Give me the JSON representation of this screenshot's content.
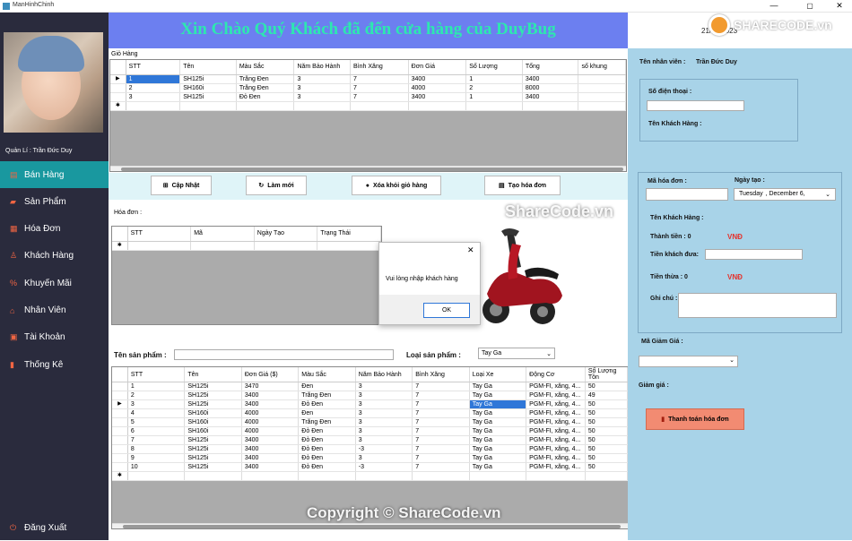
{
  "window": {
    "title": "ManHinhChinh"
  },
  "sidebar": {
    "manager_label": "Quản Lí : Trần Đức  Duy",
    "items": [
      {
        "icon": "store-icon",
        "label": "Bán Hàng"
      },
      {
        "icon": "car-icon",
        "label": "Sản Phẩm"
      },
      {
        "icon": "invoice-icon",
        "label": "Hóa Đơn"
      },
      {
        "icon": "user-icon",
        "label": "Khách Hàng"
      },
      {
        "icon": "percent-icon",
        "label": "Khuyến Mãi"
      },
      {
        "icon": "home-icon",
        "label": "Nhân Viên"
      },
      {
        "icon": "card-icon",
        "label": "Tài Khoản"
      },
      {
        "icon": "chart-icon",
        "label": "Thống Kê"
      }
    ],
    "logout_label": "Đăng Xuất"
  },
  "banner": {
    "text": "Xin Chào Quý Khách đã đến cửa hàng của DuyBug",
    "date": "21/09/2023"
  },
  "cart": {
    "label": "Giỏ Hàng",
    "columns": [
      "STT",
      "Tên",
      "Màu Sắc",
      "Năm Bảo Hành",
      "Bình Xăng",
      "Đơn Giá",
      "Số Lượng",
      "Tổng",
      "số khung"
    ],
    "rows": [
      [
        "1",
        "SH125i",
        "Trắng Đen",
        "3",
        "7",
        "3400",
        "1",
        "3400",
        ""
      ],
      [
        "2",
        "SH160i",
        "Trắng Đen",
        "3",
        "7",
        "4000",
        "2",
        "8000",
        ""
      ],
      [
        "3",
        "SH125i",
        "Đỏ Đen",
        "3",
        "7",
        "3400",
        "1",
        "3400",
        ""
      ]
    ]
  },
  "buttons": {
    "update": "Cập Nhật",
    "refresh": "Làm mới",
    "remove": "Xóa khỏi giỏ hàng",
    "create_invoice": "Tạo hóa đơn"
  },
  "invoice": {
    "label": "Hóa đơn :",
    "columns": [
      "STT",
      "Mã",
      "Ngày Tạo",
      "Trạng Thái"
    ]
  },
  "products": {
    "name_label": "Tên sản phẩm :",
    "name_value": "",
    "type_label": "Loại sản phẩm :",
    "type_value": "Tay Ga",
    "columns": [
      "STT",
      "Tên",
      "Đơn Giá ($)",
      "Màu Sắc",
      "Năm Bảo Hành",
      "Bình Xăng",
      "Loại Xe",
      "Động Cơ",
      "Số Lượng Tồn"
    ],
    "rows": [
      [
        "1",
        "SH125i",
        "3470",
        "Đen",
        "3",
        "7",
        "Tay Ga",
        "PGM-FI, xăng, 4...",
        "50"
      ],
      [
        "2",
        "SH125i",
        "3400",
        "Trắng Đen",
        "3",
        "7",
        "Tay Ga",
        "PGM-FI, xăng, 4...",
        "49"
      ],
      [
        "3",
        "SH125i",
        "3400",
        "Đỏ Đen",
        "3",
        "7",
        "Tay Ga",
        "PGM-FI, xăng, 4...",
        "50"
      ],
      [
        "4",
        "SH160i",
        "4000",
        "Đen",
        "3",
        "7",
        "Tay Ga",
        "PGM-FI, xăng, 4...",
        "50"
      ],
      [
        "5",
        "SH160i",
        "4000",
        "Trắng Đen",
        "3",
        "7",
        "Tay Ga",
        "PGM-FI, xăng, 4...",
        "50"
      ],
      [
        "6",
        "SH160i",
        "4000",
        "Đỏ Đen",
        "3",
        "7",
        "Tay Ga",
        "PGM-FI, xăng, 4...",
        "50"
      ],
      [
        "7",
        "SH125i",
        "3400",
        "Đỏ Đen",
        "3",
        "7",
        "Tay Ga",
        "PGM-FI, xăng, 4...",
        "50"
      ],
      [
        "8",
        "SH125i",
        "3400",
        "Đỏ Đen",
        "-3",
        "7",
        "Tay Ga",
        "PGM-FI, xăng, 4...",
        "50"
      ],
      [
        "9",
        "SH125i",
        "3400",
        "Đỏ Đen",
        "3",
        "7",
        "Tay Ga",
        "PGM-FI, xăng, 4...",
        "50"
      ],
      [
        "10",
        "SH125i",
        "3400",
        "Đỏ Đen",
        "-3",
        "7",
        "Tay Ga",
        "PGM-FI, xăng, 4...",
        "50"
      ]
    ]
  },
  "right": {
    "staff_label": "Tên nhân viên :",
    "staff_value": "Trần Đức  Duy",
    "phone_label": "Số điện thoại :",
    "customer_label": "Tên Khách Hàng :",
    "invoice_code_label": "Mã hóa đơn :",
    "created_label": "Ngày tạo :",
    "date_day": "Tuesday",
    "date_rest": ", December  6,",
    "customer_label2": "Tên Khách Hàng :",
    "total_label": "Thành tiền : 0",
    "currency": "VNĐ",
    "paid_label": "Tiền khách đưa:",
    "change_label": "Tiền thừa :  0",
    "currency2": "VNĐ",
    "note_label": "Ghi chú :",
    "voucher_label": "Mã Giảm Giá :",
    "discount_label": "Giảm giá :",
    "pay_button": "Thanh toán hóa đơn"
  },
  "dialog": {
    "message": "Vui lòng nhập khách hàng",
    "ok": "OK"
  },
  "watermark": {
    "logo": "SHARECODE.vn",
    "center": "ShareCode.vn",
    "bottom": "Copyright © ShareCode.vn"
  },
  "colors": {
    "sidebar": "#2a2b3d",
    "active": "#19989f",
    "banner": "#6c7ff0",
    "banner_text": "#2de8b0",
    "panel": "#a8d3e8",
    "pay": "#f28b72",
    "vnd": "#e5322b"
  }
}
